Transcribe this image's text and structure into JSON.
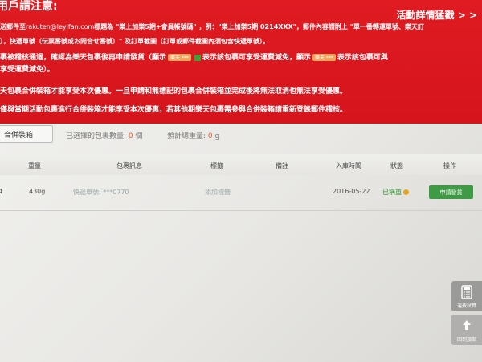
{
  "banner": {
    "title": "用戶請注意:",
    "more_link": "活動詳情猛戳 > >",
    "line1": {
      "a": "送郵件至",
      "email": "rakuten@leyifan.com",
      "b": "標題為 \"樂上加樂5期+會員帳號碼\" ，例：\"樂上加樂5期 0214XXX\"，郵件內容請附上 \"單一番轉運單號、樂天訂"
    },
    "line2": "），快遞單號（伝票番號或お問合せ番號）\" 及訂單截圖（訂單或郵件截圖內須包含快遞單號）。",
    "line3": {
      "a": "裹被稽核通過，確認為樂天包裹後再申請發貨（顯示",
      "pill1": "樂天 ***",
      "b": "表示該包裹可享受運費減免，顯示",
      "pill2": "樂天 ***",
      "c": "表示該包裹可與"
    },
    "line4": "享受運費減免）。",
    "line5": "天包裹合併裝箱才能享受本次優惠。一旦申請和無標記的包裹合併裝箱並完成後將無法取消也無法享受優惠。",
    "line6": "僅與當期活動包裹進行合併裝箱才能享受本次優惠，若其他期樂天包裹需參與合併裝箱請重新登錄郵件稽核。",
    "color": "#d9161d"
  },
  "toolbar": {
    "merge_label": "合併裝箱",
    "selected_label": "已選擇的包裹數量:",
    "selected_count": "0",
    "selected_unit": "個",
    "weight_label": "預計總重量:",
    "weight_value": "0",
    "weight_unit": "g"
  },
  "table": {
    "headers": [
      "重量",
      "包裹訊息",
      "標籤",
      "備註",
      "入庫時間",
      "狀態",
      "操作"
    ],
    "row": {
      "id_fragment": "4",
      "weight": "430g",
      "info": "快遞單號: ***0770",
      "tag": "添加標籤",
      "date": "2016-05-22",
      "status": "已稱重",
      "action": "申請發貨"
    }
  },
  "side": {
    "calc_label": "運費試算",
    "top_label": "回到頂部"
  },
  "colors": {
    "accent_green": "#3e9a44",
    "accent_orange": "#e55a2a"
  }
}
